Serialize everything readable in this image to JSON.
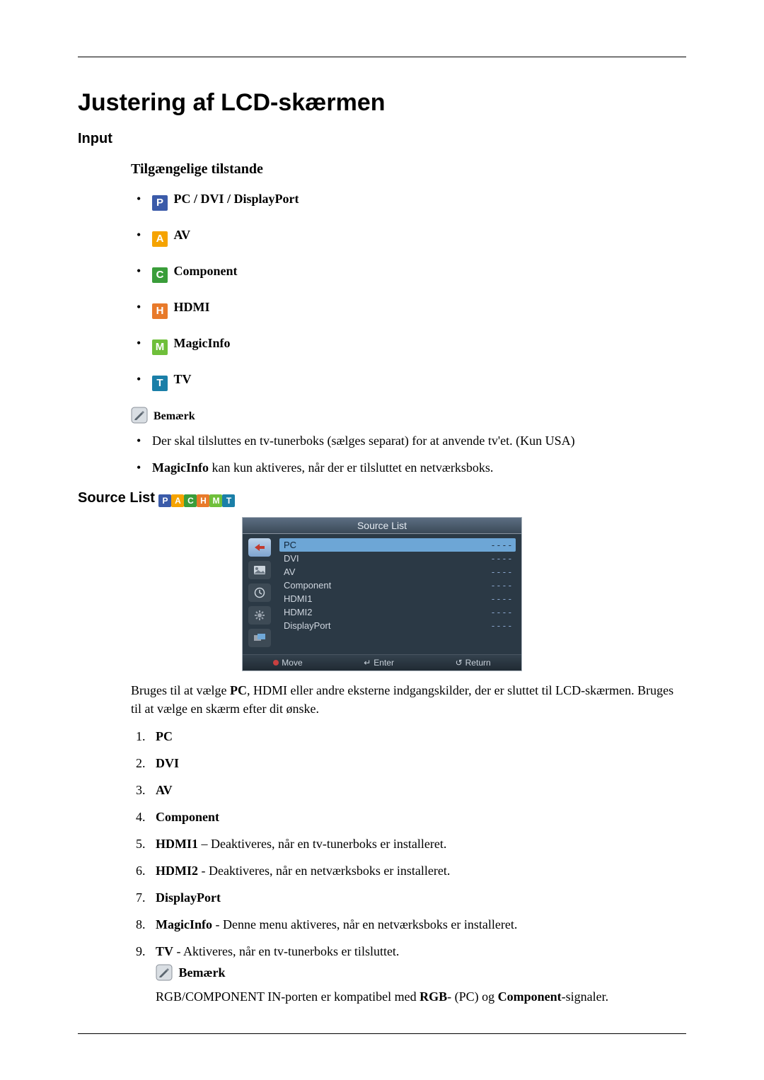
{
  "title": "Justering af LCD-skærmen",
  "section_input": "Input",
  "heading_modes": "Tilgængelige tilstande",
  "modes": {
    "pc": "PC / DVI / DisplayPort",
    "av": "AV",
    "component": "Component",
    "hdmi": "HDMI",
    "magicinfo": "MagicInfo",
    "tv": "TV"
  },
  "note_label": "Bemærk",
  "note_items": {
    "a": "Der skal tilsluttes en tv-tunerboks (sælges separat) for at anvende tv'et. (Kun USA)",
    "b_strong": "MagicInfo",
    "b_rest": " kan kun aktiveres, når der er tilsluttet en netværksboks."
  },
  "section_source_list": "Source List ",
  "osd": {
    "title": "Source List",
    "rows": {
      "pc": {
        "k": "PC",
        "v": "- - - -"
      },
      "dvi": {
        "k": "DVI",
        "v": "- - - -"
      },
      "av": {
        "k": "AV",
        "v": "- - - -"
      },
      "component": {
        "k": "Component",
        "v": "- - - -"
      },
      "hdmi1": {
        "k": "HDMI1",
        "v": "- - - -"
      },
      "hdmi2": {
        "k": "HDMI2",
        "v": "- - - -"
      },
      "displayport": {
        "k": "DisplayPort",
        "v": "- - - -"
      }
    },
    "foot": {
      "move": "Move",
      "enter": "Enter",
      "return": "Return"
    }
  },
  "src_desc_a": "Bruges til at vælge ",
  "src_desc_pc": "PC",
  "src_desc_b": ", HDMI eller andre eksterne indgangskilder, der er sluttet til LCD-skærmen. Bruges til at vælge en skærm efter dit ønske.",
  "numbered": {
    "i1": "PC",
    "i2": "DVI",
    "i3": "AV",
    "i4": "Component",
    "i5b": "HDMI1",
    "i5r": " – Deaktiveres, når en tv-tunerboks er installeret.",
    "i6b": "HDMI2",
    "i6r": " - Deaktiveres, når en netværksboks er installeret.",
    "i7": "DisplayPort",
    "i8b": "MagicInfo",
    "i8r": " - Denne menu aktiveres, når en netværksboks er installeret.",
    "i9b": "TV",
    "i9r": " - Aktiveres, når en tv-tunerboks er tilsluttet."
  },
  "note2_label": "Bemærk",
  "note2_a": "RGB/COMPONENT IN-porten er kompatibel med ",
  "note2_rgb": "RGB",
  "note2_b": "- (PC) og ",
  "note2_comp": "Component",
  "note2_c": "-signaler."
}
